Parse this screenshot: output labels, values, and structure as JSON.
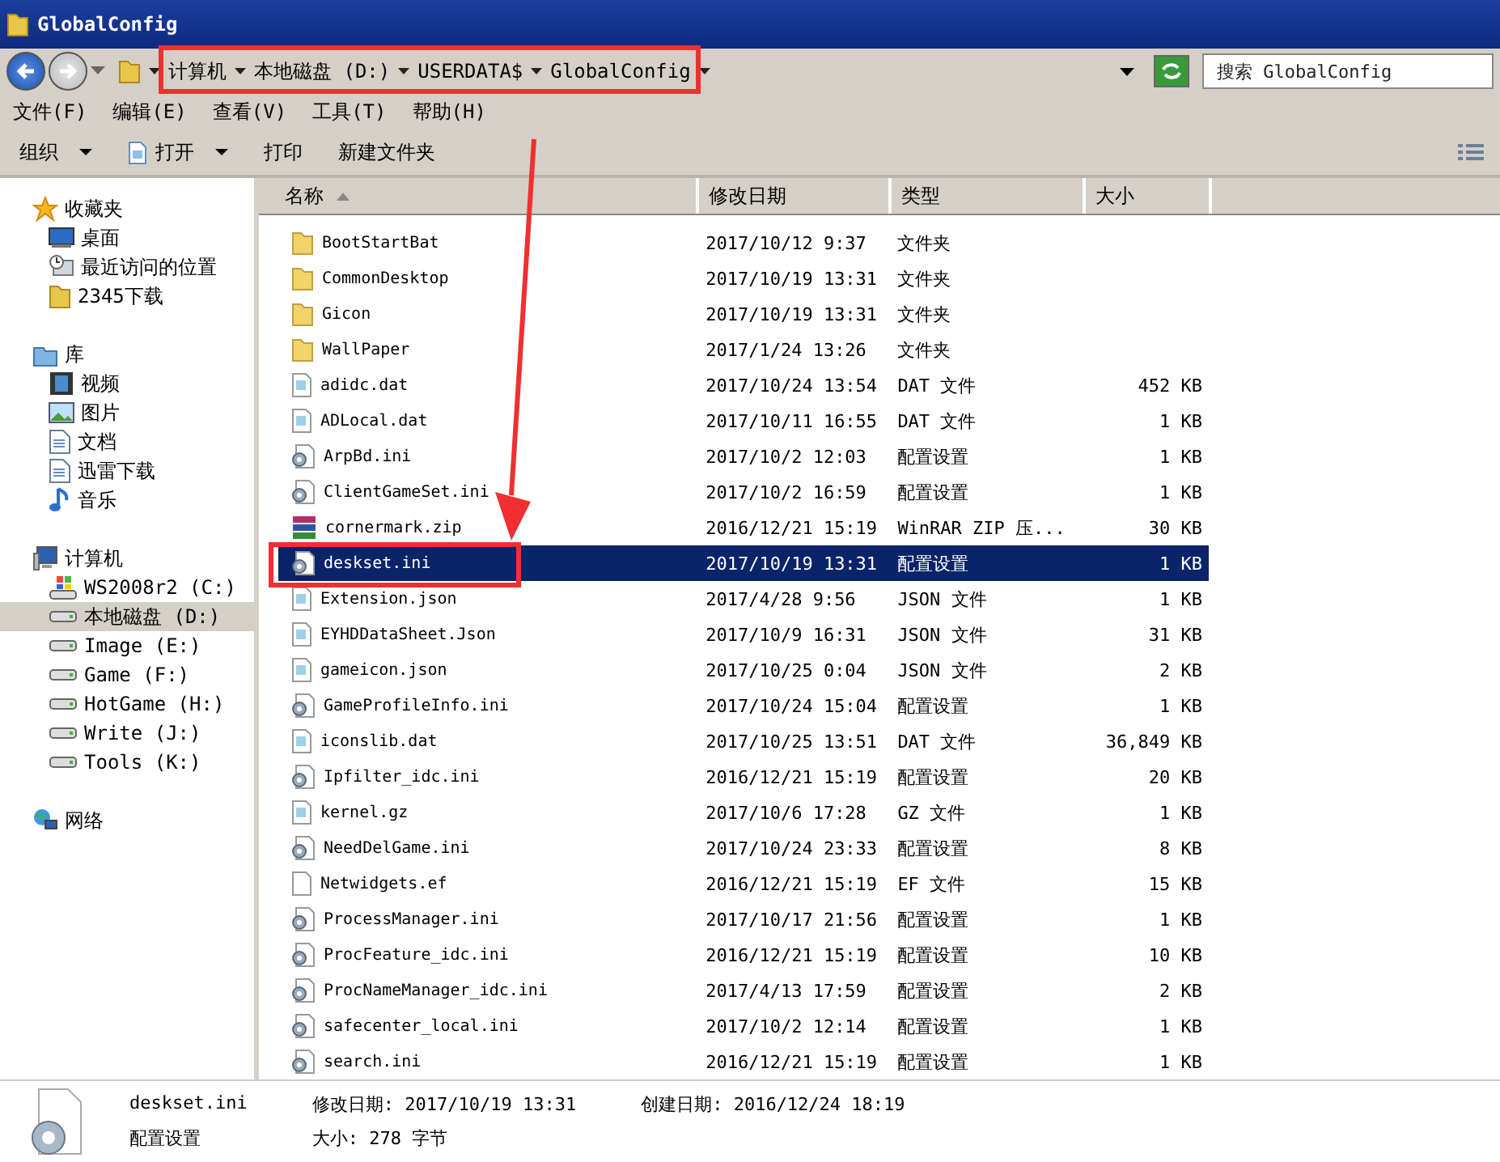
{
  "window": {
    "title": "GlobalConfig"
  },
  "address": {
    "crumbs": [
      "计算机",
      "本地磁盘 (D:)",
      "USERDATA$",
      "GlobalConfig"
    ]
  },
  "search": {
    "placeholder": "搜索 GlobalConfig"
  },
  "menu": [
    "文件(F)",
    "编辑(E)",
    "查看(V)",
    "工具(T)",
    "帮助(H)"
  ],
  "toolbar": [
    {
      "label": "组织",
      "dropdown": true,
      "icon": false
    },
    {
      "label": "打开",
      "dropdown": true,
      "icon": true
    },
    {
      "label": "打印",
      "dropdown": false,
      "icon": false
    },
    {
      "label": "新建文件夹",
      "dropdown": false,
      "icon": false
    }
  ],
  "sidebar": {
    "groups": [
      {
        "label": "收藏夹",
        "kind": "star",
        "children": [
          {
            "label": "桌面",
            "kind": "desktop",
            "selected": false
          },
          {
            "label": "最近访问的位置",
            "kind": "recent",
            "selected": false
          },
          {
            "label": "2345下载",
            "kind": "folder",
            "selected": false
          }
        ]
      },
      {
        "label": "库",
        "kind": "library",
        "children": [
          {
            "label": "视频",
            "kind": "video",
            "selected": false
          },
          {
            "label": "图片",
            "kind": "image",
            "selected": false
          },
          {
            "label": "文档",
            "kind": "doc",
            "selected": false
          },
          {
            "label": "迅雷下载",
            "kind": "doc",
            "selected": false
          },
          {
            "label": "音乐",
            "kind": "music",
            "selected": false
          }
        ]
      },
      {
        "label": "计算机",
        "kind": "computer",
        "children": [
          {
            "label": "WS2008r2 (C:)",
            "kind": "sysdrive",
            "selected": false
          },
          {
            "label": "本地磁盘 (D:)",
            "kind": "drive",
            "selected": true
          },
          {
            "label": "Image (E:)",
            "kind": "drive",
            "selected": false
          },
          {
            "label": "Game (F:)",
            "kind": "drive",
            "selected": false
          },
          {
            "label": "HotGame (H:)",
            "kind": "drive",
            "selected": false
          },
          {
            "label": "Write (J:)",
            "kind": "drive",
            "selected": false
          },
          {
            "label": "Tools (K:)",
            "kind": "drive",
            "selected": false
          }
        ]
      },
      {
        "label": "网络",
        "kind": "network"
      }
    ]
  },
  "table": {
    "columns": [
      "名称",
      "修改日期",
      "类型",
      "大小"
    ],
    "rows": [
      {
        "name": "BootStartBat",
        "date": "2017/10/12 9:37",
        "type": "文件夹",
        "kind": "folder",
        "selected": false
      },
      {
        "name": "CommonDesktop",
        "date": "2017/10/19 13:31",
        "type": "文件夹",
        "kind": "folder",
        "selected": false
      },
      {
        "name": "Gicon",
        "date": "2017/10/19 13:31",
        "type": "文件夹",
        "kind": "folder",
        "selected": false
      },
      {
        "name": "WallPaper",
        "date": "2017/1/24 13:26",
        "type": "文件夹",
        "kind": "folder",
        "selected": false
      },
      {
        "name": "adidc.dat",
        "date": "2017/10/24 13:54",
        "type": "DAT 文件",
        "size": "452 KB",
        "kind": "file",
        "selected": false
      },
      {
        "name": "ADLocal.dat",
        "date": "2017/10/11 16:55",
        "type": "DAT 文件",
        "size": "1 KB",
        "kind": "file",
        "selected": false
      },
      {
        "name": "ArpBd.ini",
        "date": "2017/10/2 12:03",
        "type": "配置设置",
        "size": "1 KB",
        "kind": "config",
        "selected": false
      },
      {
        "name": "ClientGameSet.ini",
        "date": "2017/10/2 16:59",
        "type": "配置设置",
        "size": "1 KB",
        "kind": "config",
        "selected": false
      },
      {
        "name": "cornermark.zip",
        "date": "2016/12/21 15:19",
        "type": "WinRAR ZIP 压...",
        "size": "30 KB",
        "kind": "zip",
        "selected": false
      },
      {
        "name": "deskset.ini",
        "date": "2017/10/19 13:31",
        "type": "配置设置",
        "size": "1 KB",
        "kind": "config",
        "selected": true
      },
      {
        "name": "Extension.json",
        "date": "2017/4/28 9:56",
        "type": "JSON 文件",
        "size": "1 KB",
        "kind": "file",
        "selected": false
      },
      {
        "name": "EYHDDataSheet.Json",
        "date": "2017/10/9 16:31",
        "type": "JSON 文件",
        "size": "31 KB",
        "kind": "file",
        "selected": false
      },
      {
        "name": "gameicon.json",
        "date": "2017/10/25 0:04",
        "type": "JSON 文件",
        "size": "2 KB",
        "kind": "file",
        "selected": false
      },
      {
        "name": "GameProfileInfo.ini",
        "date": "2017/10/24 15:04",
        "type": "配置设置",
        "size": "1 KB",
        "kind": "config",
        "selected": false
      },
      {
        "name": "iconslib.dat",
        "date": "2017/10/25 13:51",
        "type": "DAT 文件",
        "size": "36,849 KB",
        "kind": "file",
        "selected": false
      },
      {
        "name": "Ipfilter_idc.ini",
        "date": "2016/12/21 15:19",
        "type": "配置设置",
        "size": "20 KB",
        "kind": "config",
        "selected": false
      },
      {
        "name": "kernel.gz",
        "date": "2017/10/6 17:28",
        "type": "GZ 文件",
        "size": "1 KB",
        "kind": "file",
        "selected": false
      },
      {
        "name": "NeedDelGame.ini",
        "date": "2017/10/24 23:33",
        "type": "配置设置",
        "size": "8 KB",
        "kind": "config",
        "selected": false
      },
      {
        "name": "Netwidgets.ef",
        "date": "2016/12/21 15:19",
        "type": "EF 文件",
        "size": "15 KB",
        "kind": "blank",
        "selected": false
      },
      {
        "name": "ProcessManager.ini",
        "date": "2017/10/17 21:56",
        "type": "配置设置",
        "size": "1 KB",
        "kind": "config",
        "selected": false
      },
      {
        "name": "ProcFeature_idc.ini",
        "date": "2016/12/21 15:19",
        "type": "配置设置",
        "size": "10 KB",
        "kind": "config",
        "selected": false
      },
      {
        "name": "ProcNameManager_idc.ini",
        "date": "2017/4/13 17:59",
        "type": "配置设置",
        "size": "2 KB",
        "kind": "config",
        "selected": false
      },
      {
        "name": "safecenter_local.ini",
        "date": "2017/10/2 12:14",
        "type": "配置设置",
        "size": "1 KB",
        "kind": "config",
        "selected": false
      },
      {
        "name": "search.ini",
        "date": "2016/12/21 15:19",
        "type": "配置设置",
        "size": "1 KB",
        "kind": "config",
        "selected": false
      }
    ]
  },
  "details": {
    "name": "deskset.ini",
    "modified": "修改日期: 2017/10/19 13:31",
    "created": "创建日期: 2016/12/24 18:19",
    "type": "配置设置",
    "size": "大小: 278 字节"
  }
}
